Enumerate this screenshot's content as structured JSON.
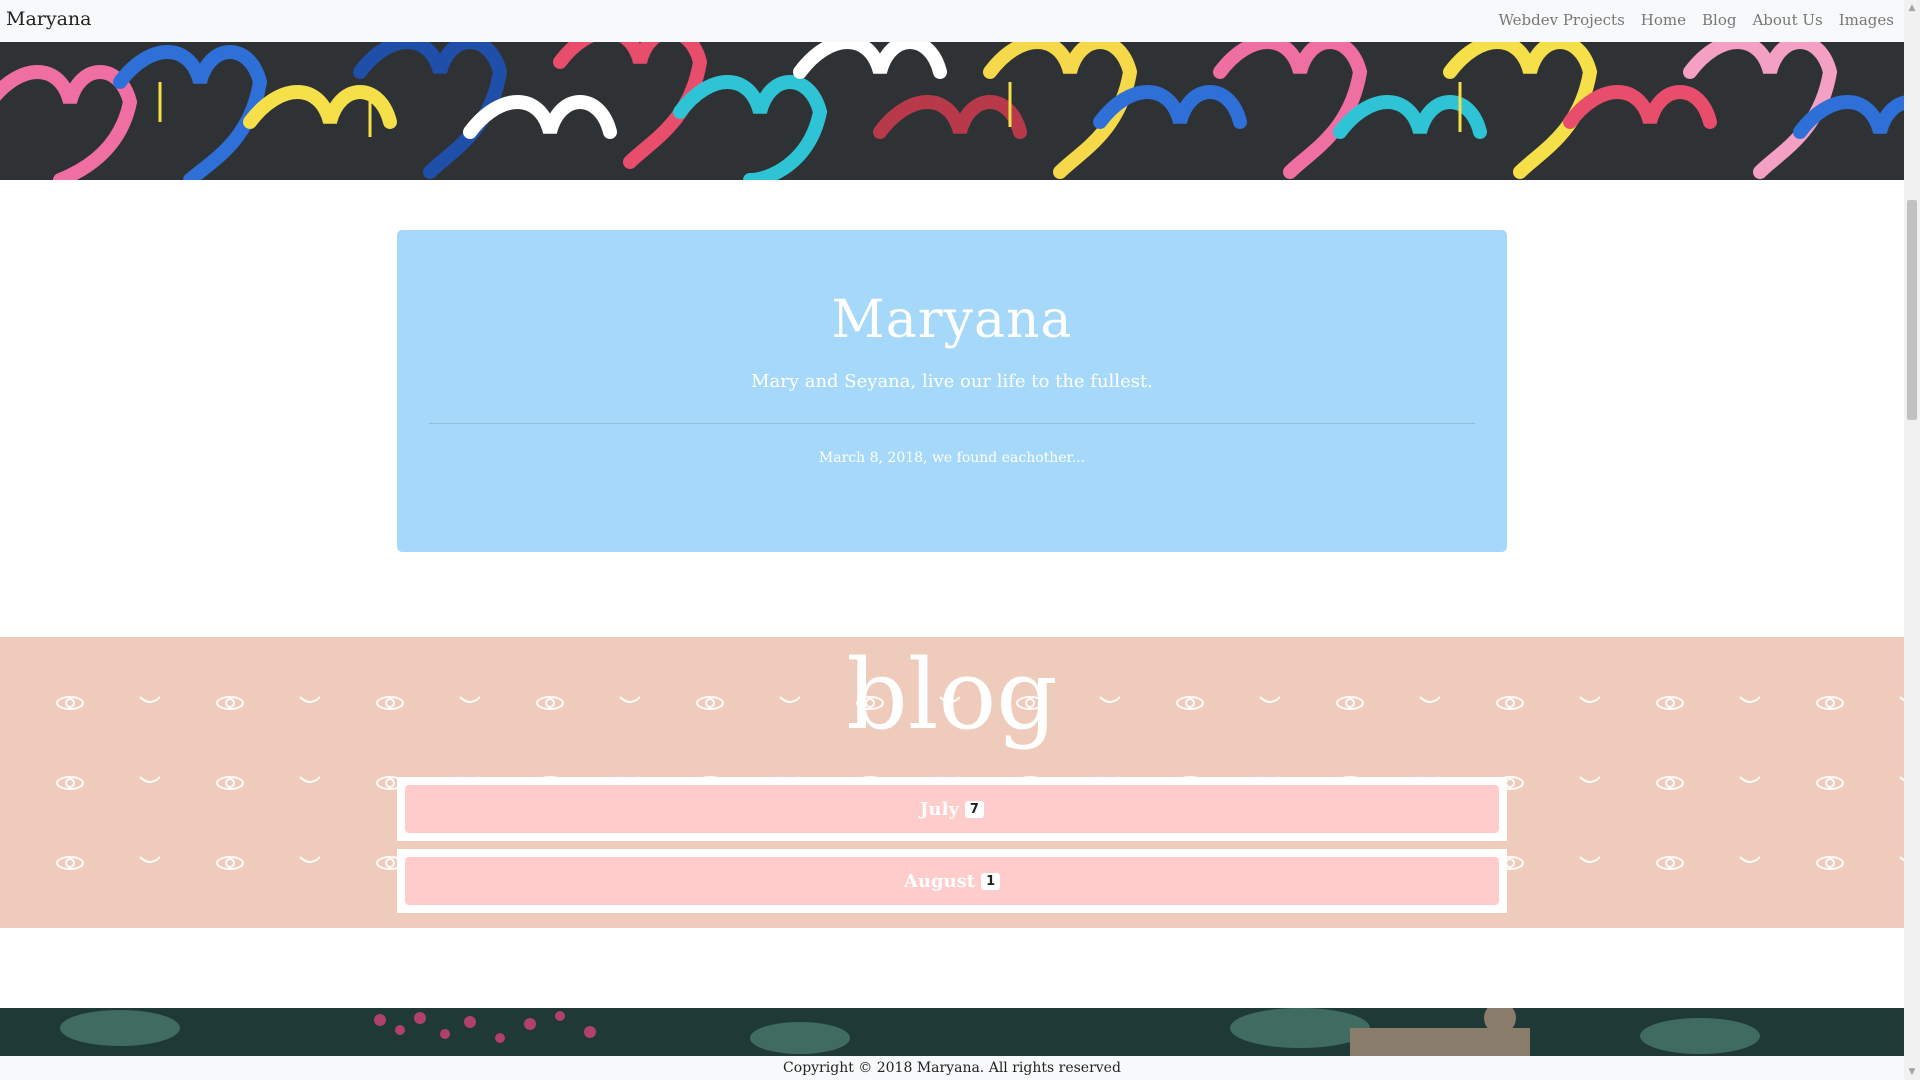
{
  "navbar": {
    "brand": "Maryana",
    "links": [
      "Webdev Projects",
      "Home",
      "Blog",
      "About Us",
      "Images"
    ]
  },
  "hero": {
    "image": "colorful-graffiti-hearts-image"
  },
  "jumbotron": {
    "title": "Maryana",
    "subtitle": "Mary and Seyana, live our life to the fullest.",
    "date_text": "March 8, 2018, we found eachother..."
  },
  "blog": {
    "title": "blog",
    "months": [
      {
        "label": "July",
        "count": "7"
      },
      {
        "label": "August",
        "count": "1"
      }
    ]
  },
  "bottom_image": {
    "image": "flowers-and-leaves-image"
  },
  "footer": {
    "copyright": "Copyright © 2018 Maryana. All rights reserved"
  },
  "colors": {
    "jumbotron_bg": "#a6d9f9",
    "blog_section_bg": "#efcbbb",
    "month_button_bg": "#ffcccc",
    "navbar_bg": "#f8f9fa"
  }
}
